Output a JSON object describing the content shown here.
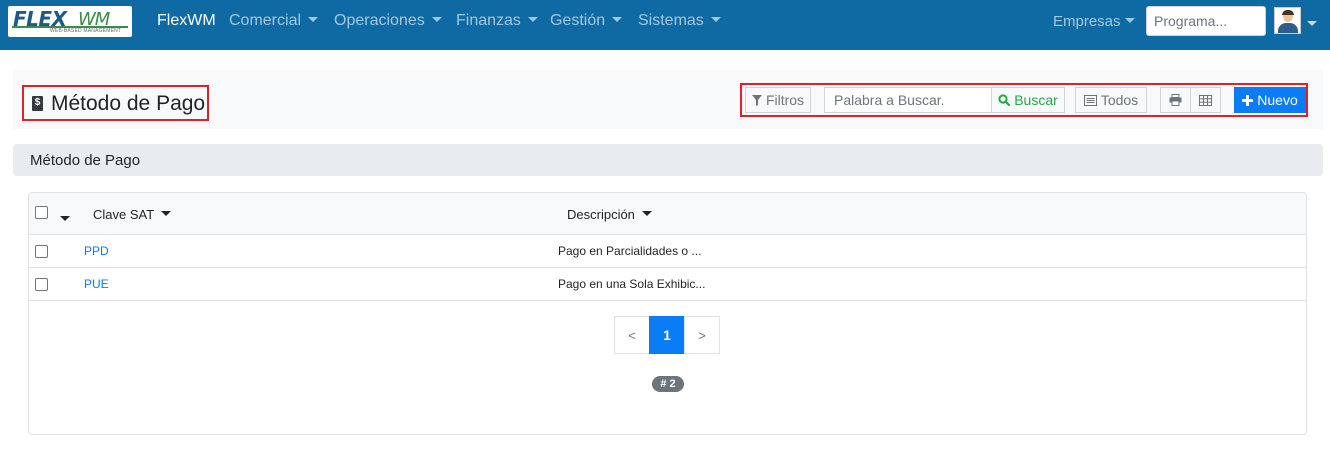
{
  "navbar": {
    "logo_text": "FLEX",
    "logo_text_2": "WM",
    "logo_subtitle": "WEB-BASED MANAGEMENT",
    "brand": "FlexWM",
    "menus": [
      "Comercial",
      "Operaciones",
      "Finanzas",
      "Gestión",
      "Sistemas"
    ],
    "empresas": "Empresas",
    "program_placeholder": "Programa...",
    "accent_color": "#0f6aa3"
  },
  "header": {
    "title": "Método de Pago",
    "title_icon": "file-dollar-icon",
    "toolbar": {
      "filters_label": "Filtros",
      "search_placeholder": "Palabra a Buscar.",
      "search_button": "Buscar",
      "all_label": "Todos",
      "print_icon": "print-icon",
      "table_icon": "table-icon",
      "new_label": "Nuevo"
    }
  },
  "section": {
    "title": "Método de Pago"
  },
  "table": {
    "columns": [
      "Clave SAT",
      "Descripción"
    ],
    "rows": [
      {
        "clave": "PPD",
        "descripcion": "Pago en Parcialidades o ..."
      },
      {
        "clave": "PUE",
        "descripcion": "Pago en una Sola Exhibic..."
      }
    ],
    "pagination": {
      "prev": "<",
      "current": "1",
      "next": ">"
    },
    "count_badge": "# 2"
  },
  "colors": {
    "highlight_border": "#e41f26",
    "primary_button": "#0a7cf5",
    "search_button_text": "#28a745"
  }
}
